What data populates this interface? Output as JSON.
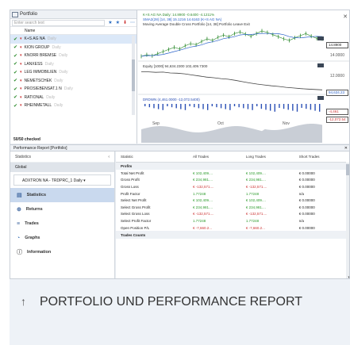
{
  "portfolio": {
    "title": "Portfolio",
    "search_placeholder": "Enter search text",
    "column_name": "Name",
    "rows": [
      {
        "name": "K+S AG NA",
        "suffix": "Daily"
      },
      {
        "name": "KION GROUP",
        "suffix": "Daily"
      },
      {
        "name": "KNORR BREMSE",
        "suffix": "Daily"
      },
      {
        "name": "LANXESS",
        "suffix": "Daily"
      },
      {
        "name": "LEG IMMOBILIEN",
        "suffix": "Daily"
      },
      {
        "name": "NEMETSCHEK",
        "suffix": "Daily"
      },
      {
        "name": "PROSIEBENSAT.1 N",
        "suffix": "Daily"
      },
      {
        "name": "RATIONAL",
        "suffix": "Daily"
      },
      {
        "name": "RHEINMETALL",
        "suffix": "Daily"
      }
    ],
    "count": "50/50 checked"
  },
  "chart": {
    "legend1": "K+S AG NA Daily: 14.8900 -0.6400 -4.1211%",
    "legend2": "SMA2(28) [14, 38] 15.1216 14.6163 (K+S AG NA)",
    "legend3": "Moving Average Double Cross Portfolio [14, 38]   Portfolio Leave Exit",
    "legend_equity": "Equity [1000] 94,634.2300 102,409.7300",
    "legend_drawdown": "DRDWN (4,461.0000 -12,072.5400)",
    "price_labels": [
      "14.8900",
      "14.0000",
      "12.0000"
    ],
    "equity_label": "94,634.23",
    "dd_labels": [
      "-4,461",
      "-12,072.54"
    ],
    "months": [
      "Sep",
      "Oct",
      "Nov"
    ],
    "price_series": [
      11.6,
      11.9,
      11.7,
      12.1,
      12.5,
      12.9,
      13.3,
      13.0,
      13.6,
      14.0,
      13.8,
      14.4,
      14.9,
      14.6,
      15.2,
      15.6,
      15.3,
      15.9,
      16.2,
      15.8,
      15.4,
      15.9,
      16.4,
      16.1,
      15.7,
      15.3,
      14.9,
      14.6,
      15.1,
      15.5,
      15.9,
      15.4,
      15.0,
      14.9
    ],
    "equity_series": [
      103000,
      102900,
      102700,
      102800,
      102400,
      102300,
      102000,
      101500,
      101000,
      100500,
      100200,
      99800,
      99500,
      99000,
      98400,
      97800,
      97300,
      96900,
      96500,
      96200,
      95800,
      95500,
      95200,
      95000,
      94800,
      94634
    ],
    "colors": {
      "price": "#2e8b2e",
      "sma": "#2a62c9",
      "equity": "#444444",
      "drawdown": "#2a4fb5",
      "shade": "#c9ced6"
    }
  },
  "report": {
    "title": "Performance Report [Portfolio]",
    "sidebar_header": "Statistics",
    "scope": "Global",
    "account": "ADXTRON NA - TRDPRC_1 Daily",
    "nav": [
      {
        "label": "Statistics",
        "icon": "statistics-icon"
      },
      {
        "label": "Returns",
        "icon": "returns-icon"
      },
      {
        "label": "Trades",
        "icon": "trades-icon"
      },
      {
        "label": "Graphs",
        "icon": "graphs-icon"
      },
      {
        "label": "Information",
        "icon": "information-icon"
      }
    ],
    "columns": [
      "Statistic",
      "All Trades",
      "Long Trades",
      "Short Trades"
    ],
    "section_profits": "Profits",
    "rows": [
      {
        "stat": "Total Net Profit",
        "all": "€ 102,409....",
        "long": "€ 102,409....",
        "short": "€ 0.00000"
      },
      {
        "stat": "Gross Profit",
        "all": "€ 234,981....",
        "long": "€ 234,981....",
        "short": "€ 0.00000"
      },
      {
        "stat": "Gross Loss",
        "all": "€ -132,571....",
        "long": "€ -132,571....",
        "short": "€ 0.00000"
      },
      {
        "stat": "Profit Factor",
        "all": "1.77248",
        "long": "1.77248",
        "short": "n/a"
      },
      {
        "stat": "Select Net Profit",
        "all": "€ 102,409....",
        "long": "€ 102,409....",
        "short": "€ 0.00000"
      },
      {
        "stat": "Select Gross Profit",
        "all": "€ 234,981....",
        "long": "€ 234,981....",
        "short": "€ 0.00000"
      },
      {
        "stat": "Select Gross Loss",
        "all": "€ -132,571....",
        "long": "€ -132,571....",
        "short": "€ 0.00000"
      },
      {
        "stat": "Select Profit Factor",
        "all": "1.77248",
        "long": "1.77248",
        "short": "n/a"
      },
      {
        "stat": "Open Position P/L",
        "all": "€ -7,660.2...",
        "long": "€ -7,660.2...",
        "short": "€ 0.00000"
      }
    ],
    "section_trades": "Trades Counts"
  },
  "caption": {
    "arrow_icon": "arrow-up-icon",
    "text": "PORTFOLIO UND PERFORMANCE REPORT"
  }
}
